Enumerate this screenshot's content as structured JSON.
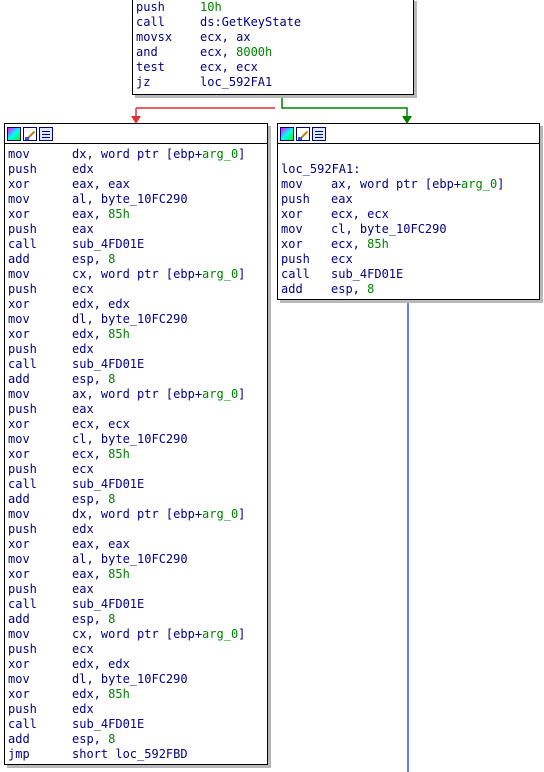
{
  "top_block": {
    "lines": [
      {
        "mnemonic": "push",
        "operands": [
          {
            "t": "10h",
            "c": "num"
          }
        ]
      },
      {
        "mnemonic": "call",
        "operands": [
          {
            "t": "ds:GetKeyState",
            "c": ""
          }
        ]
      },
      {
        "mnemonic": "movsx",
        "operands": [
          {
            "t": "ecx, ax",
            "c": ""
          }
        ]
      },
      {
        "mnemonic": "and",
        "operands": [
          {
            "t": "ecx, ",
            "c": ""
          },
          {
            "t": "8000h",
            "c": "num"
          }
        ]
      },
      {
        "mnemonic": "test",
        "operands": [
          {
            "t": "ecx, ecx",
            "c": ""
          }
        ]
      },
      {
        "mnemonic": "jz",
        "operands": [
          {
            "t": "loc_592FA1",
            "c": ""
          }
        ]
      }
    ]
  },
  "left_block": {
    "lines": [
      {
        "mnemonic": "mov",
        "operands": [
          {
            "t": "dx, word ptr [ebp+",
            "c": ""
          },
          {
            "t": "arg_0",
            "c": "var"
          },
          {
            "t": "]",
            "c": ""
          }
        ]
      },
      {
        "mnemonic": "push",
        "operands": [
          {
            "t": "edx",
            "c": ""
          }
        ]
      },
      {
        "mnemonic": "xor",
        "operands": [
          {
            "t": "eax, eax",
            "c": ""
          }
        ]
      },
      {
        "mnemonic": "mov",
        "operands": [
          {
            "t": "al, byte_10FC290",
            "c": ""
          }
        ]
      },
      {
        "mnemonic": "xor",
        "operands": [
          {
            "t": "eax, ",
            "c": ""
          },
          {
            "t": "85h",
            "c": "num"
          }
        ]
      },
      {
        "mnemonic": "push",
        "operands": [
          {
            "t": "eax",
            "c": ""
          }
        ]
      },
      {
        "mnemonic": "call",
        "operands": [
          {
            "t": "sub_4FD01E",
            "c": ""
          }
        ]
      },
      {
        "mnemonic": "add",
        "operands": [
          {
            "t": "esp, ",
            "c": ""
          },
          {
            "t": "8",
            "c": "num"
          }
        ]
      },
      {
        "mnemonic": "mov",
        "operands": [
          {
            "t": "cx, word ptr [ebp+",
            "c": ""
          },
          {
            "t": "arg_0",
            "c": "var"
          },
          {
            "t": "]",
            "c": ""
          }
        ]
      },
      {
        "mnemonic": "push",
        "operands": [
          {
            "t": "ecx",
            "c": ""
          }
        ]
      },
      {
        "mnemonic": "xor",
        "operands": [
          {
            "t": "edx, edx",
            "c": ""
          }
        ]
      },
      {
        "mnemonic": "mov",
        "operands": [
          {
            "t": "dl, byte_10FC290",
            "c": ""
          }
        ]
      },
      {
        "mnemonic": "xor",
        "operands": [
          {
            "t": "edx, ",
            "c": ""
          },
          {
            "t": "85h",
            "c": "num"
          }
        ]
      },
      {
        "mnemonic": "push",
        "operands": [
          {
            "t": "edx",
            "c": ""
          }
        ]
      },
      {
        "mnemonic": "call",
        "operands": [
          {
            "t": "sub_4FD01E",
            "c": ""
          }
        ]
      },
      {
        "mnemonic": "add",
        "operands": [
          {
            "t": "esp, ",
            "c": ""
          },
          {
            "t": "8",
            "c": "num"
          }
        ]
      },
      {
        "mnemonic": "mov",
        "operands": [
          {
            "t": "ax, word ptr [ebp+",
            "c": ""
          },
          {
            "t": "arg_0",
            "c": "var"
          },
          {
            "t": "]",
            "c": ""
          }
        ]
      },
      {
        "mnemonic": "push",
        "operands": [
          {
            "t": "eax",
            "c": ""
          }
        ]
      },
      {
        "mnemonic": "xor",
        "operands": [
          {
            "t": "ecx, ecx",
            "c": ""
          }
        ]
      },
      {
        "mnemonic": "mov",
        "operands": [
          {
            "t": "cl, byte_10FC290",
            "c": ""
          }
        ]
      },
      {
        "mnemonic": "xor",
        "operands": [
          {
            "t": "ecx, ",
            "c": ""
          },
          {
            "t": "85h",
            "c": "num"
          }
        ]
      },
      {
        "mnemonic": "push",
        "operands": [
          {
            "t": "ecx",
            "c": ""
          }
        ]
      },
      {
        "mnemonic": "call",
        "operands": [
          {
            "t": "sub_4FD01E",
            "c": ""
          }
        ]
      },
      {
        "mnemonic": "add",
        "operands": [
          {
            "t": "esp, ",
            "c": ""
          },
          {
            "t": "8",
            "c": "num"
          }
        ]
      },
      {
        "mnemonic": "mov",
        "operands": [
          {
            "t": "dx, word ptr [ebp+",
            "c": ""
          },
          {
            "t": "arg_0",
            "c": "var"
          },
          {
            "t": "]",
            "c": ""
          }
        ]
      },
      {
        "mnemonic": "push",
        "operands": [
          {
            "t": "edx",
            "c": ""
          }
        ]
      },
      {
        "mnemonic": "xor",
        "operands": [
          {
            "t": "eax, eax",
            "c": ""
          }
        ]
      },
      {
        "mnemonic": "mov",
        "operands": [
          {
            "t": "al, byte_10FC290",
            "c": ""
          }
        ]
      },
      {
        "mnemonic": "xor",
        "operands": [
          {
            "t": "eax, ",
            "c": ""
          },
          {
            "t": "85h",
            "c": "num"
          }
        ]
      },
      {
        "mnemonic": "push",
        "operands": [
          {
            "t": "eax",
            "c": ""
          }
        ]
      },
      {
        "mnemonic": "call",
        "operands": [
          {
            "t": "sub_4FD01E",
            "c": ""
          }
        ]
      },
      {
        "mnemonic": "add",
        "operands": [
          {
            "t": "esp, ",
            "c": ""
          },
          {
            "t": "8",
            "c": "num"
          }
        ]
      },
      {
        "mnemonic": "mov",
        "operands": [
          {
            "t": "cx, word ptr [ebp+",
            "c": ""
          },
          {
            "t": "arg_0",
            "c": "var"
          },
          {
            "t": "]",
            "c": ""
          }
        ]
      },
      {
        "mnemonic": "push",
        "operands": [
          {
            "t": "ecx",
            "c": ""
          }
        ]
      },
      {
        "mnemonic": "xor",
        "operands": [
          {
            "t": "edx, edx",
            "c": ""
          }
        ]
      },
      {
        "mnemonic": "mov",
        "operands": [
          {
            "t": "dl, byte_10FC290",
            "c": ""
          }
        ]
      },
      {
        "mnemonic": "xor",
        "operands": [
          {
            "t": "edx, ",
            "c": ""
          },
          {
            "t": "85h",
            "c": "num"
          }
        ]
      },
      {
        "mnemonic": "push",
        "operands": [
          {
            "t": "edx",
            "c": ""
          }
        ]
      },
      {
        "mnemonic": "call",
        "operands": [
          {
            "t": "sub_4FD01E",
            "c": ""
          }
        ]
      },
      {
        "mnemonic": "add",
        "operands": [
          {
            "t": "esp, ",
            "c": ""
          },
          {
            "t": "8",
            "c": "num"
          }
        ]
      },
      {
        "mnemonic": "jmp",
        "operands": [
          {
            "t": "short loc_592FBD",
            "c": ""
          }
        ]
      }
    ]
  },
  "right_block": {
    "label": "loc_592FA1:",
    "lines": [
      {
        "mnemonic": "mov",
        "operands": [
          {
            "t": "ax, word ptr [ebp+",
            "c": ""
          },
          {
            "t": "arg_0",
            "c": "var"
          },
          {
            "t": "]",
            "c": ""
          }
        ]
      },
      {
        "mnemonic": "push",
        "operands": [
          {
            "t": "eax",
            "c": ""
          }
        ]
      },
      {
        "mnemonic": "xor",
        "operands": [
          {
            "t": "ecx, ecx",
            "c": ""
          }
        ]
      },
      {
        "mnemonic": "mov",
        "operands": [
          {
            "t": "cl, byte_10FC290",
            "c": ""
          }
        ]
      },
      {
        "mnemonic": "xor",
        "operands": [
          {
            "t": "ecx, ",
            "c": ""
          },
          {
            "t": "85h",
            "c": "num"
          }
        ]
      },
      {
        "mnemonic": "push",
        "operands": [
          {
            "t": "ecx",
            "c": ""
          }
        ]
      },
      {
        "mnemonic": "call",
        "operands": [
          {
            "t": "sub_4FD01E",
            "c": ""
          }
        ]
      },
      {
        "mnemonic": "add",
        "operands": [
          {
            "t": "esp, ",
            "c": ""
          },
          {
            "t": "8",
            "c": "num"
          }
        ]
      }
    ]
  },
  "colors": {
    "false_edge": "#e03030",
    "true_edge": "#008000",
    "flow_edge": "#6b7fd8",
    "text": "#000080",
    "constant": "#008000"
  },
  "titlebar_icons": [
    "graph-overview-icon",
    "rename-icon",
    "list-view-icon"
  ]
}
